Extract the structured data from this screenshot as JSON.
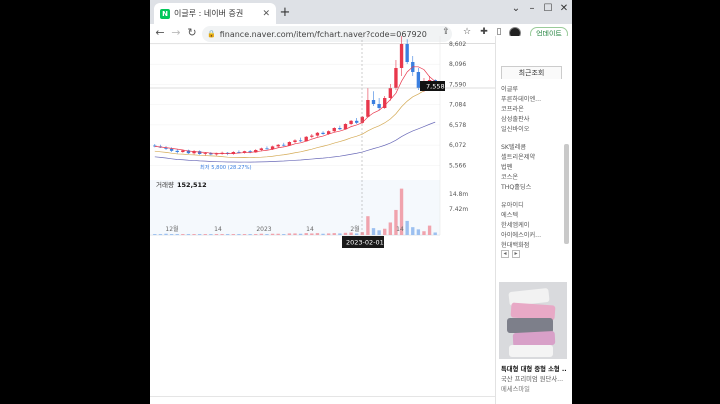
{
  "browser": {
    "tab_title": "이글루 : 네이버 증권",
    "tab_favicon": "N",
    "url": "finance.naver.com/item/fchart.naver?code=067920",
    "update_label": "업데이트"
  },
  "chart": {
    "price_ticks": [
      "8,602",
      "8,096",
      "7,590",
      "7,084",
      "6,578",
      "6,072",
      "5,566"
    ],
    "current_price": "7,558",
    "low_annotation": "최저 5,800 (28.27%)",
    "volume_label": "거래량",
    "volume_value": "152,512",
    "volume_ticks": [
      "14.8m",
      "7.42m"
    ],
    "x_labels": [
      "12월",
      "14",
      "2023",
      "14",
      "2월",
      "14"
    ],
    "crosshair_date": "2023-02-01",
    "colors": {
      "up": "#e8374c",
      "down": "#3a7fe0",
      "ma5": "#e8374c",
      "ma20": "#d4aa55",
      "ma60": "#6a6ab8"
    }
  },
  "chart_data": {
    "type": "candlestick",
    "ylim": [
      5300,
      8800
    ],
    "candles": [
      [
        6060,
        6100,
        6020,
        6040
      ],
      [
        6040,
        6080,
        6000,
        6010
      ],
      [
        6010,
        6050,
        5950,
        5980
      ],
      [
        5980,
        6020,
        5900,
        5930
      ],
      [
        5930,
        5970,
        5860,
        5900
      ],
      [
        5900,
        5960,
        5880,
        5940
      ],
      [
        5940,
        5960,
        5850,
        5870
      ],
      [
        5870,
        5950,
        5840,
        5920
      ],
      [
        5920,
        5940,
        5830,
        5850
      ],
      [
        5850,
        5900,
        5800,
        5870
      ],
      [
        5870,
        5900,
        5820,
        5840
      ],
      [
        5840,
        5880,
        5810,
        5860
      ],
      [
        5860,
        5910,
        5830,
        5880
      ],
      [
        5880,
        5900,
        5820,
        5850
      ],
      [
        5850,
        5920,
        5830,
        5900
      ],
      [
        5900,
        5940,
        5870,
        5880
      ],
      [
        5880,
        5930,
        5860,
        5920
      ],
      [
        5920,
        5950,
        5870,
        5890
      ],
      [
        5890,
        5970,
        5880,
        5950
      ],
      [
        5950,
        6010,
        5920,
        5990
      ],
      [
        5990,
        6040,
        5960,
        5970
      ],
      [
        5970,
        6060,
        5950,
        6040
      ],
      [
        6040,
        6100,
        6010,
        6080
      ],
      [
        6080,
        6130,
        6040,
        6060
      ],
      [
        6060,
        6170,
        6050,
        6150
      ],
      [
        6150,
        6220,
        6120,
        6190
      ],
      [
        6190,
        6260,
        6150,
        6170
      ],
      [
        6170,
        6300,
        6160,
        6280
      ],
      [
        6280,
        6350,
        6240,
        6310
      ],
      [
        6310,
        6400,
        6280,
        6380
      ],
      [
        6380,
        6420,
        6330,
        6350
      ],
      [
        6350,
        6440,
        6330,
        6420
      ],
      [
        6420,
        6520,
        6400,
        6500
      ],
      [
        6500,
        6560,
        6450,
        6470
      ],
      [
        6470,
        6620,
        6460,
        6600
      ],
      [
        6600,
        6700,
        6570,
        6680
      ],
      [
        6680,
        6750,
        6600,
        6630
      ],
      [
        6630,
        6800,
        6610,
        6780
      ],
      [
        6780,
        7500,
        6760,
        7200
      ],
      [
        7200,
        7420,
        7050,
        7100
      ],
      [
        7100,
        7250,
        6950,
        7000
      ],
      [
        7000,
        7300,
        6980,
        7250
      ],
      [
        7250,
        7600,
        7180,
        7500
      ],
      [
        7500,
        8200,
        7450,
        8000
      ],
      [
        8000,
        8800,
        7800,
        8600
      ],
      [
        8600,
        8720,
        8100,
        8150
      ],
      [
        8150,
        8300,
        7800,
        7900
      ],
      [
        7900,
        8000,
        7450,
        7500
      ],
      [
        7500,
        7750,
        7400,
        7650
      ],
      [
        7650,
        7800,
        7550,
        7700
      ],
      [
        7700,
        7720,
        7500,
        7558
      ]
    ],
    "volume_up_days": [
      38,
      42,
      43,
      44
    ],
    "volume_values": [
      0.3,
      0.3,
      0.4,
      0.3,
      0.3,
      0.3,
      0.3,
      0.3,
      0.3,
      0.3,
      0.3,
      0.3,
      0.3,
      0.3,
      0.3,
      0.3,
      0.3,
      0.3,
      0.3,
      0.4,
      0.3,
      0.4,
      0.4,
      0.3,
      0.5,
      0.5,
      0.4,
      0.6,
      0.5,
      0.6,
      0.4,
      0.5,
      0.6,
      0.5,
      0.7,
      0.8,
      0.5,
      0.9,
      6.0,
      2.2,
      1.5,
      2.0,
      4.0,
      8.0,
      14.8,
      4.5,
      2.5,
      1.8,
      1.2,
      3.0,
      0.8
    ]
  },
  "sidebar": {
    "recent_label": "최근조회",
    "group1": [
      "이글루",
      "푸른하데이엔...",
      "코프라온",
      "삼성출판사",
      "일신바이오"
    ],
    "group2": [
      "SK텔레콤",
      "셀트리온제약",
      "법펜",
      "코스온",
      "THQ홀딩스"
    ],
    "group3": [
      "유아이디",
      "에스텍",
      "한세엠케이",
      "아이에스이커...",
      "현대백화점"
    ],
    "pager_prev": "◂",
    "pager_next": "▸"
  },
  "ad": {
    "title": "특대형 대형 중형 소형 ...",
    "subtitle": "국산 프리미엄 원단사...",
    "brand": "메세스마일"
  }
}
